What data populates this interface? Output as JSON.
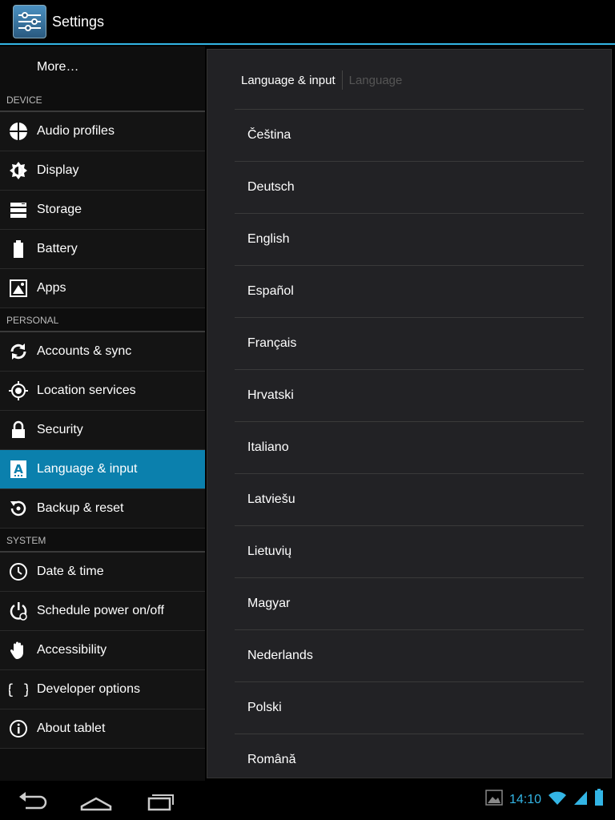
{
  "app": {
    "title": "Settings"
  },
  "sidebar": {
    "more_label": "More…",
    "sections": {
      "device": "DEVICE",
      "personal": "PERSONAL",
      "system": "SYSTEM"
    },
    "device_items": [
      {
        "label": "Audio profiles",
        "icon": "audio-profiles-icon"
      },
      {
        "label": "Display",
        "icon": "display-icon"
      },
      {
        "label": "Storage",
        "icon": "storage-icon"
      },
      {
        "label": "Battery",
        "icon": "battery-icon"
      },
      {
        "label": "Apps",
        "icon": "apps-icon"
      }
    ],
    "personal_items": [
      {
        "label": "Accounts & sync",
        "icon": "sync-icon"
      },
      {
        "label": "Location services",
        "icon": "location-icon"
      },
      {
        "label": "Security",
        "icon": "lock-icon"
      },
      {
        "label": "Language & input",
        "icon": "language-icon",
        "selected": true
      },
      {
        "label": "Backup & reset",
        "icon": "backup-icon"
      }
    ],
    "system_items": [
      {
        "label": "Date & time",
        "icon": "clock-icon"
      },
      {
        "label": "Schedule power on/off",
        "icon": "power-icon"
      },
      {
        "label": "Accessibility",
        "icon": "hand-icon"
      },
      {
        "label": "Developer options",
        "icon": "braces-icon"
      },
      {
        "label": "About tablet",
        "icon": "info-icon"
      }
    ]
  },
  "panel": {
    "breadcrumb_current": "Language & input",
    "breadcrumb_next": "Language",
    "languages": [
      "Čeština",
      "Deutsch",
      "English",
      "Español",
      "Français",
      "Hrvatski",
      "Italiano",
      "Latviešu",
      "Lietuvių",
      "Magyar",
      "Nederlands",
      "Polski",
      "Română"
    ]
  },
  "statusbar": {
    "time": "14:10"
  },
  "colors": {
    "accent": "#33b5e5",
    "selected": "#0b80ad"
  }
}
